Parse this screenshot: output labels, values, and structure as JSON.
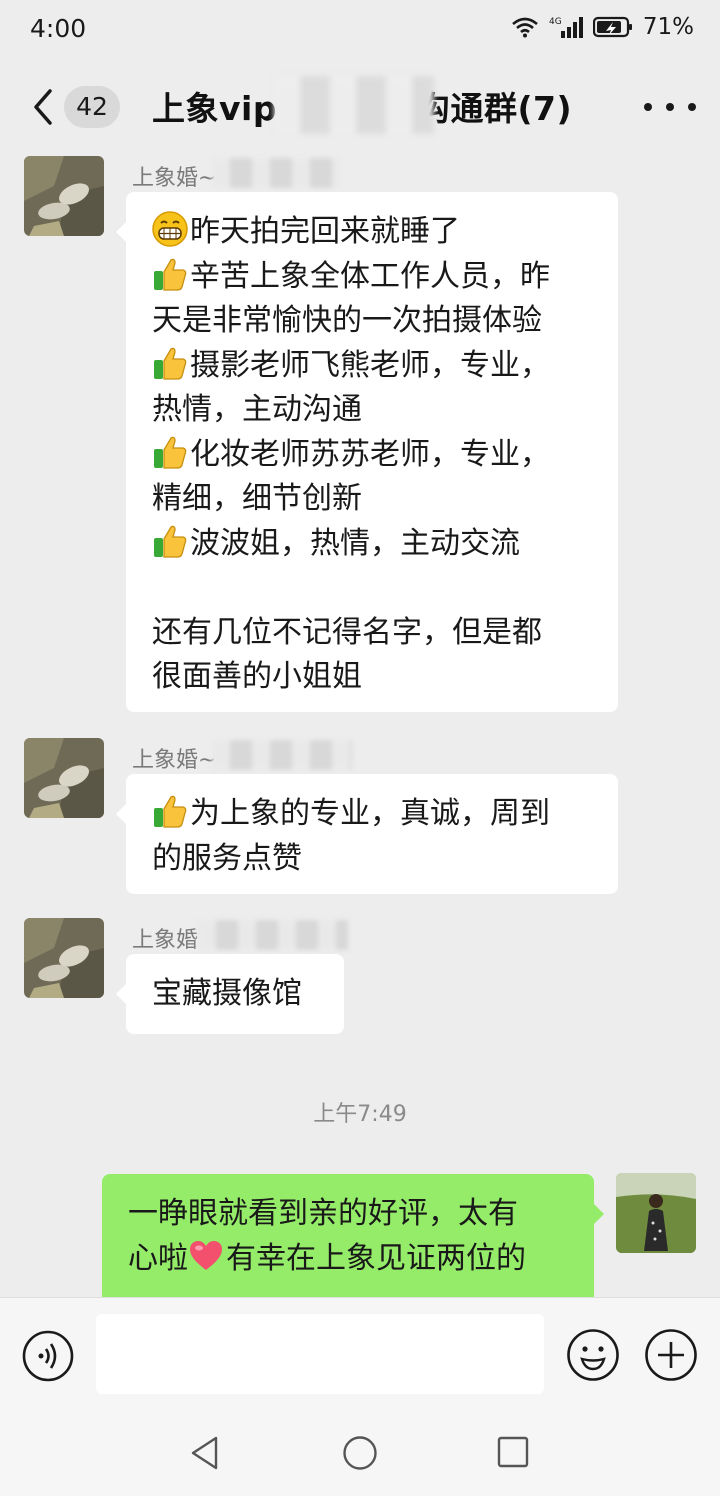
{
  "status_bar": {
    "time": "4:00",
    "battery": "71%",
    "network": "4G"
  },
  "header": {
    "title": "上象vip",
    "title_suffix": "沟通群(7)",
    "unread_count": "42"
  },
  "messages": [
    {
      "sender": "上象婚~",
      "lines": [
        {
          "emoji": "grin-emoji",
          "text": "昨天拍完回来就睡了"
        },
        {
          "emoji": "thumbs-up-emoji",
          "text": "辛苦上象全体工作人员，昨"
        },
        {
          "emoji": "",
          "text": "天是非常愉快的一次拍摄体验"
        },
        {
          "emoji": "thumbs-up-emoji",
          "text": "摄影老师飞熊老师，专业，"
        },
        {
          "emoji": "",
          "text": "热情，主动沟通"
        },
        {
          "emoji": "thumbs-up-emoji",
          "text": "化妆老师苏苏老师，专业，"
        },
        {
          "emoji": "",
          "text": "精细，细节创新"
        },
        {
          "emoji": "thumbs-up-emoji",
          "text": "波波姐，热情，主动交流"
        },
        {
          "emoji": "",
          "text": ""
        },
        {
          "emoji": "",
          "text": "还有几位不记得名字，但是都"
        },
        {
          "emoji": "",
          "text": "很面善的小姐姐"
        }
      ]
    },
    {
      "sender": "上象婚~",
      "lines": [
        {
          "emoji": "thumbs-up-emoji",
          "text": "为上象的专业，真诚，周到"
        },
        {
          "emoji": "",
          "text": "的服务点赞"
        }
      ]
    },
    {
      "sender": "上象婚",
      "lines": [
        {
          "emoji": "",
          "text": "宝藏摄像馆"
        }
      ]
    }
  ],
  "timestamp": "上午7:49",
  "my_message": {
    "line1": "一睁眼就看到亲的好评，太有",
    "line2_before": "心啦",
    "line2_emoji": "heart-emoji",
    "line2_after": "有幸在上象见证两位的"
  },
  "input": {
    "placeholder": ""
  },
  "colors": {
    "background": "#ededed",
    "bubble_white": "#ffffff",
    "bubble_green": "#95ec69"
  }
}
